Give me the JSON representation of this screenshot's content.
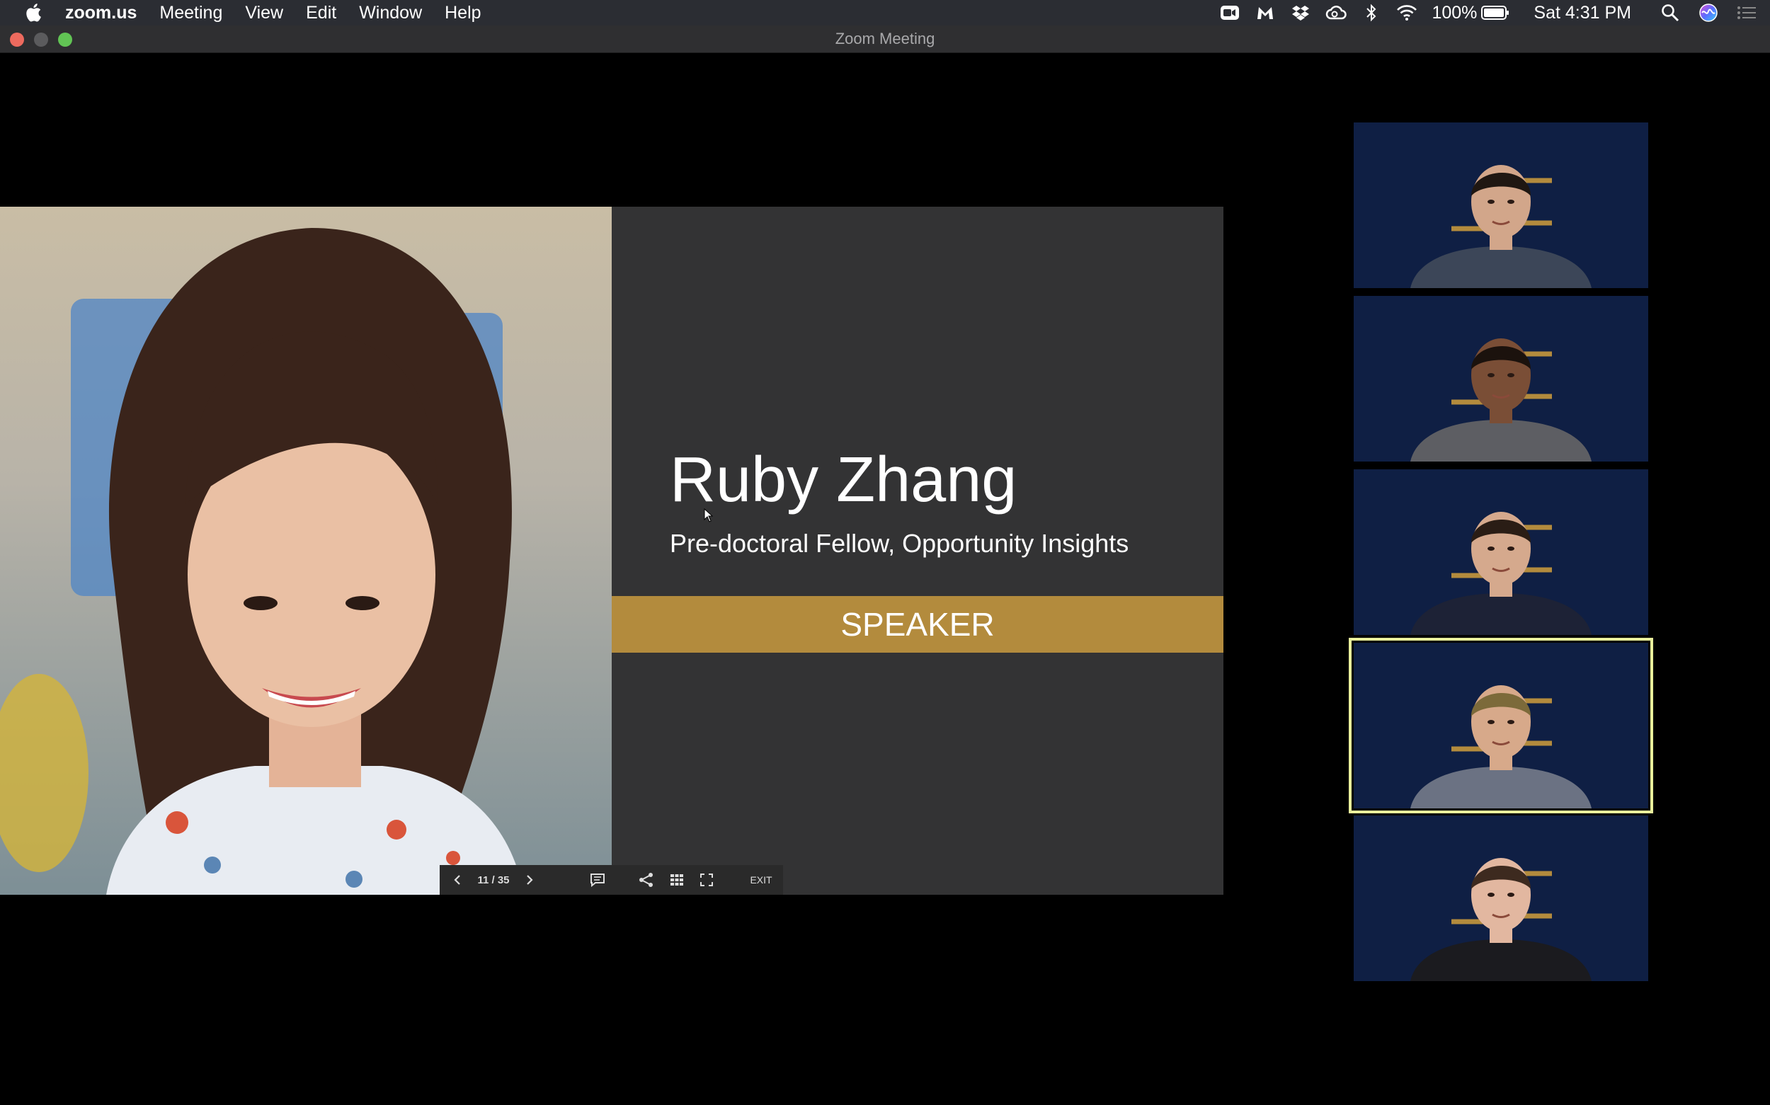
{
  "menubar": {
    "app_name": "zoom.us",
    "menus": [
      "Meeting",
      "View",
      "Edit",
      "Window",
      "Help"
    ],
    "battery": "100%",
    "clock": "Sat 4:31 PM"
  },
  "window": {
    "title": "Zoom Meeting"
  },
  "slide": {
    "name": "Ruby Zhang",
    "role": "Pre-doctoral Fellow, Opportunity Insights",
    "band": "SPEAKER"
  },
  "controls": {
    "page": "11 / 35",
    "exit": "EXIT"
  },
  "participants": [
    {
      "skin": "#d2a68a",
      "hair": "#1f1712",
      "clothes": "#3c4658",
      "active": false
    },
    {
      "skin": "#7a4e36",
      "hair": "#1b120d",
      "clothes": "#5d5e63",
      "active": false
    },
    {
      "skin": "#d5a98d",
      "hair": "#2a1d15",
      "clothes": "#1d2236",
      "active": false
    },
    {
      "skin": "#d7a98a",
      "hair": "#7c6a3a",
      "clothes": "#6b7283",
      "active": true
    },
    {
      "skin": "#e2b7a0",
      "hair": "#3d2a1f",
      "clothes": "#1b1b1f",
      "active": false
    }
  ],
  "colors": {
    "accent_gold": "#b38b3d",
    "tile_bg": "#0f1f44",
    "active_border": "#e9ef9c"
  }
}
